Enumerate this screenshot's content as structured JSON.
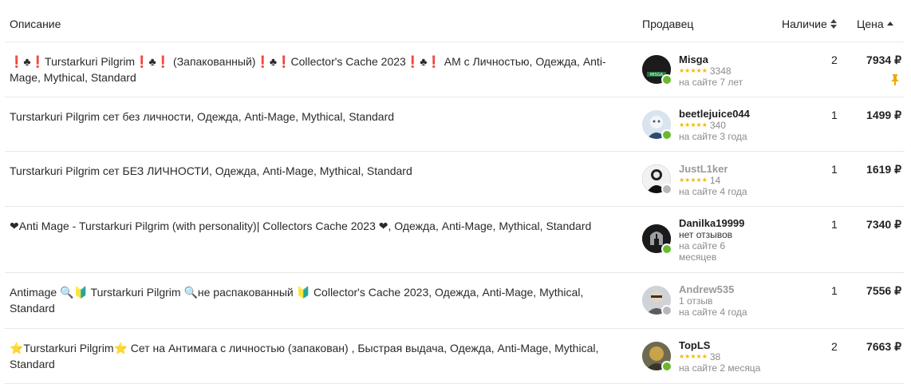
{
  "header": {
    "description": "Описание",
    "seller": "Продавец",
    "stock": "Наличие",
    "price": "Цена"
  },
  "rows": [
    {
      "description": "❗♣❗Turstarkuri Pilgrim❗♣❗ (Запакованный)❗♣❗Collector's Cache 2023❗♣❗ АМ с Личностью, Одежда, Anti-Mage, Mythical, Standard",
      "seller": {
        "name": "Misga",
        "rating_count": "3348",
        "since": "на сайте 7 лет",
        "online": true,
        "stars": "★★★★★",
        "avatar_text": "MISGA"
      },
      "stock": "2",
      "price": "7934 ₽",
      "pinned": true
    },
    {
      "description": "Turstarkuri Pilgrim сет без личности, Одежда, Anti-Mage, Mythical, Standard",
      "seller": {
        "name": "beetlejuice044",
        "rating_count": "340",
        "since": "на сайте 3 года",
        "online": true,
        "stars": "★★★★★"
      },
      "stock": "1",
      "price": "1499 ₽"
    },
    {
      "description": "Turstarkuri Pilgrim сет БЕЗ ЛИЧНОСТИ, Одежда, Anti-Mage, Mythical, Standard",
      "seller": {
        "name": "JustL1ker",
        "rating_count": "14",
        "since": "на сайте 4 года",
        "online": false,
        "stars": "★★★★★"
      },
      "stock": "1",
      "price": "1619 ₽"
    },
    {
      "description": "❤Anti Mage - Turstarkuri Pilgrim (with personality)| Collectors Cache 2023 ❤, Одежда, Anti-Mage, Mythical, Standard",
      "seller": {
        "name": "Danilka19999",
        "reviews_text": "нет отзывов",
        "since": "на сайте 6 месяцев",
        "online": true
      },
      "stock": "1",
      "price": "7340 ₽"
    },
    {
      "description": "Antimage 🔍🔰 Turstarkuri Pilgrim 🔍не распакованный 🔰 Collector's Cache 2023, Одежда, Anti-Mage, Mythical, Standard",
      "seller": {
        "name": "Andrew535",
        "reviews_text": "1 отзыв",
        "since": "на сайте 4 года",
        "online": false
      },
      "stock": "1",
      "price": "7556 ₽"
    },
    {
      "description": "⭐Turstarkuri Pilgrim⭐ Сет на Антимага с личностью (запакован) , Быстрая выдача, Одежда, Anti-Mage, Mythical, Standard",
      "seller": {
        "name": "TopLS",
        "rating_count": "38",
        "since": "на сайте 2 месяца",
        "online": true,
        "stars": "★★★★★"
      },
      "stock": "2",
      "price": "7663 ₽"
    }
  ],
  "colors": {
    "online": "#6ab82d",
    "offline": "#b8b8b8",
    "star": "#f5b800",
    "pin": "#f0a800"
  }
}
